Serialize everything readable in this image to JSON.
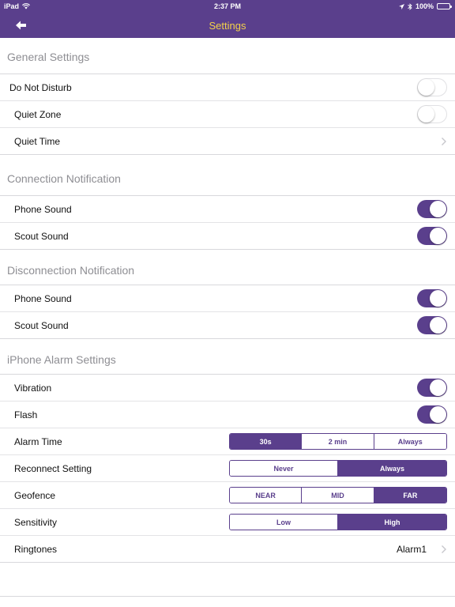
{
  "status_bar": {
    "device": "iPad",
    "time": "2:37 PM",
    "battery": "100%"
  },
  "nav": {
    "title": "Settings"
  },
  "sections": {
    "general": {
      "header": "General Settings",
      "do_not_disturb": {
        "label": "Do Not Disturb",
        "on": false
      },
      "quiet_zone": {
        "label": "Quiet Zone",
        "on": false
      },
      "quiet_time": {
        "label": "Quiet Time"
      }
    },
    "connection": {
      "header": "Connection Notification",
      "phone_sound": {
        "label": "Phone Sound",
        "on": true
      },
      "scout_sound": {
        "label": "Scout Sound",
        "on": true
      }
    },
    "disconnection": {
      "header": "Disconnection Notification",
      "phone_sound": {
        "label": "Phone Sound",
        "on": true
      },
      "scout_sound": {
        "label": "Scout Sound",
        "on": true
      }
    },
    "alarm": {
      "header": "iPhone Alarm Settings",
      "vibration": {
        "label": "Vibration",
        "on": true
      },
      "flash": {
        "label": "Flash",
        "on": true
      },
      "alarm_time": {
        "label": "Alarm Time",
        "options": [
          "30s",
          "2 min",
          "Always"
        ],
        "selected": "30s"
      },
      "reconnect": {
        "label": "Reconnect Setting",
        "options": [
          "Never",
          "Always"
        ],
        "selected": "Always"
      },
      "geofence": {
        "label": "Geofence",
        "options": [
          "NEAR",
          "MID",
          "FAR"
        ],
        "selected": "FAR"
      },
      "sensitivity": {
        "label": "Sensitivity",
        "options": [
          "Low",
          "High"
        ],
        "selected": "High"
      },
      "ringtones": {
        "label": "Ringtones",
        "value": "Alarm1"
      }
    }
  },
  "colors": {
    "accent": "#5a3f8c",
    "title": "#f3d14a",
    "header_text": "#8e8e93"
  }
}
